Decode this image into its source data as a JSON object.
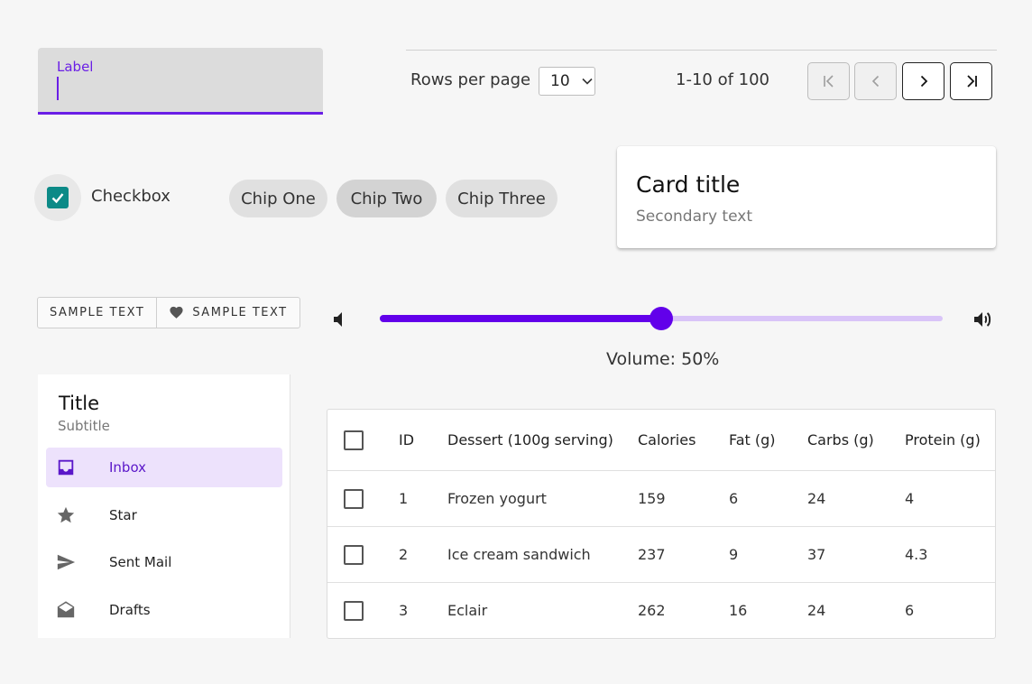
{
  "textfield": {
    "label": "Label",
    "value": ""
  },
  "pagination": {
    "rows_label": "Rows per page",
    "rows_value": "10",
    "range": "1-10 of 100"
  },
  "checkbox": {
    "label": "Checkbox",
    "checked": true,
    "color": "#0c8a87"
  },
  "chips": [
    {
      "label": "Chip One"
    },
    {
      "label": "Chip Two"
    },
    {
      "label": "Chip Three"
    }
  ],
  "card": {
    "title": "Card title",
    "secondary": "Secondary text"
  },
  "button_group": [
    {
      "label": "SAMPLE TEXT",
      "icon": ""
    },
    {
      "label": "SAMPLE TEXT",
      "icon": "heart-icon"
    }
  ],
  "slider": {
    "value_percent": 50,
    "label": "Volume: 50%",
    "color": "#6200ea"
  },
  "nav": {
    "title": "Title",
    "subtitle": "Subtitle",
    "items": [
      {
        "label": "Inbox",
        "icon": "inbox-icon",
        "active": true
      },
      {
        "label": "Star",
        "icon": "star-icon",
        "active": false
      },
      {
        "label": "Sent Mail",
        "icon": "send-icon",
        "active": false
      },
      {
        "label": "Drafts",
        "icon": "drafts-icon",
        "active": false
      }
    ]
  },
  "table": {
    "headers": [
      "ID",
      "Dessert (100g serving)",
      "Calories",
      "Fat (g)",
      "Carbs (g)",
      "Protein (g)"
    ],
    "rows": [
      [
        "1",
        "Frozen yogurt",
        "159",
        "6",
        "24",
        "4"
      ],
      [
        "2",
        "Ice cream sandwich",
        "237",
        "9",
        "37",
        "4.3"
      ],
      [
        "3",
        "Eclair",
        "262",
        "16",
        "24",
        "6"
      ]
    ]
  },
  "colors": {
    "accent": "#6a1ee6",
    "checkbox": "#0c8a87"
  }
}
